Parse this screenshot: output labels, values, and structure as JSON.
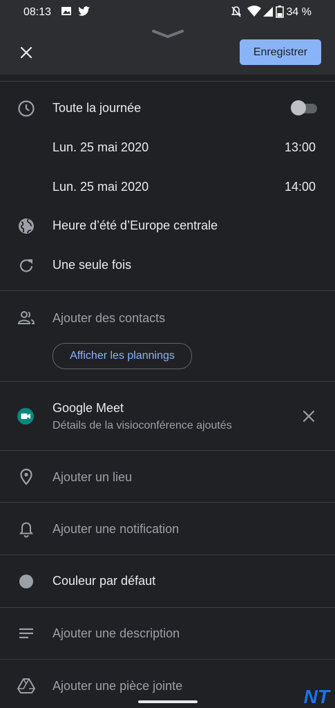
{
  "status_bar": {
    "time": "08:13",
    "battery": "34 %"
  },
  "header": {
    "save_label": "Enregistrer"
  },
  "all_day": {
    "label": "Toute la journée",
    "enabled": false
  },
  "start": {
    "date": "Lun. 25 mai 2020",
    "time": "13:00"
  },
  "end": {
    "date": "Lun. 25 mai 2020",
    "time": "14:00"
  },
  "timezone": "Heure d’été d’Europe centrale",
  "recurrence": "Une seule fois",
  "contacts": {
    "placeholder": "Ajouter des contacts",
    "schedules_button": "Afficher les plannings"
  },
  "meet": {
    "title": "Google Meet",
    "subtitle": "Détails de la visioconférence ajoutés"
  },
  "location": "Ajouter un lieu",
  "notification": "Ajouter une notification",
  "color": "Couleur par défaut",
  "description": "Ajouter une description",
  "attachment": "Ajouter une pièce jointe",
  "watermark": "NT",
  "colors": {
    "accent": "#8ab4f8",
    "background": "#202124",
    "meet_green": "#00897b"
  }
}
